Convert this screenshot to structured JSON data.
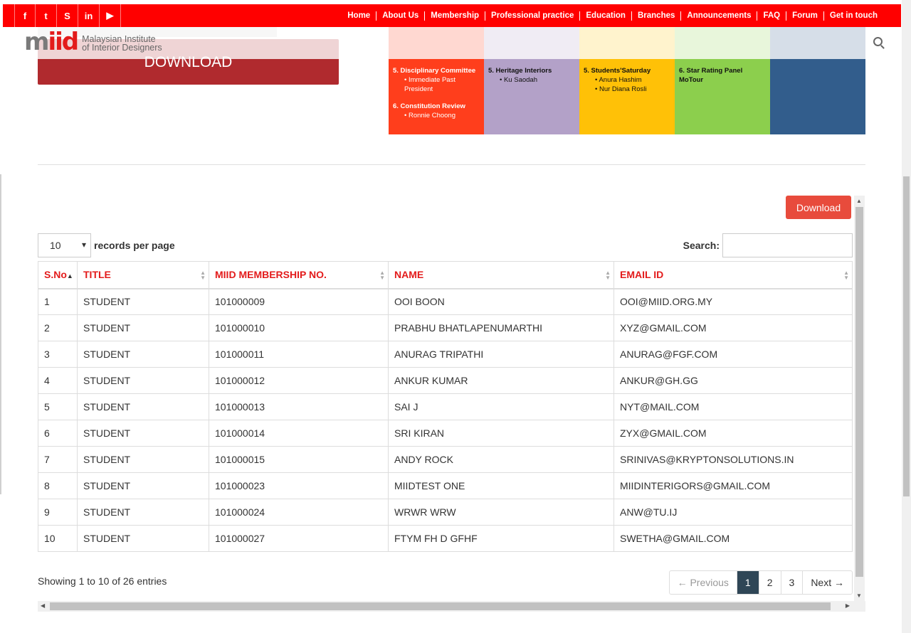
{
  "topbar": {
    "social": [
      {
        "icon": "facebook-icon",
        "glyph": "f"
      },
      {
        "icon": "twitter-icon",
        "glyph": "t"
      },
      {
        "icon": "skype-icon",
        "glyph": "S"
      },
      {
        "icon": "linkedin-icon",
        "glyph": "in"
      },
      {
        "icon": "youtube-icon",
        "glyph": "▶"
      }
    ],
    "nav": [
      "Home",
      "About Us",
      "Membership",
      "Professional practice",
      "Education",
      "Branches",
      "Announcements",
      "FAQ",
      "Forum",
      "Get in touch"
    ]
  },
  "header": {
    "logo_mark_gray": "m",
    "logo_mark_red": "iid",
    "logo_line1": "Malaysian Institute",
    "logo_line2": "of Interior Designers"
  },
  "banner": {
    "download_label": "DOWNLOAD"
  },
  "committees": {
    "col1": [
      {
        "head": "5.  Disciplinary Committee",
        "items": [
          "Immediate Past President"
        ]
      },
      {
        "head": "6.  Constitution Review",
        "items": [
          "Ronnie Choong"
        ]
      }
    ],
    "col2": [
      {
        "head": "5. Heritage Interiors",
        "items": [
          "Ku Saodah"
        ]
      }
    ],
    "col3": [
      {
        "head": "5.  Students'Saturday",
        "items": [
          "Anura Hashim",
          "Nur Diana Rosli"
        ]
      }
    ],
    "col4": [
      {
        "head": "6.  Star Rating Panel MoTour",
        "items": []
      }
    ]
  },
  "table_panel": {
    "download_button": "Download",
    "length_value": "10",
    "length_suffix": "records per page",
    "search_label": "Search:",
    "search_value": "",
    "columns": [
      "S.No",
      "TITLE",
      "MIID MEMBERSHIP NO.",
      "NAME",
      "EMAIL ID"
    ],
    "rows": [
      [
        "1",
        "STUDENT",
        "101000009",
        "OOI BOON",
        "OOI@MIID.ORG.MY"
      ],
      [
        "2",
        "STUDENT",
        "101000010",
        "PRABHU BHATLAPENUMARTHI",
        "XYZ@GMAIL.COM"
      ],
      [
        "3",
        "STUDENT",
        "101000011",
        "ANURAG TRIPATHI",
        "ANURAG@FGF.COM"
      ],
      [
        "4",
        "STUDENT",
        "101000012",
        "ANKUR KUMAR",
        "ANKUR@GH.GG"
      ],
      [
        "5",
        "STUDENT",
        "101000013",
        "SAI J",
        "NYT@MAIL.COM"
      ],
      [
        "6",
        "STUDENT",
        "101000014",
        "SRI KIRAN",
        "ZYX@GMAIL.COM"
      ],
      [
        "7",
        "STUDENT",
        "101000015",
        "ANDY ROCK",
        "SRINIVAS@KRYPTONSOLUTIONS.IN"
      ],
      [
        "8",
        "STUDENT",
        "101000023",
        "MIIDTEST ONE",
        "MIIDINTERIGORS@GMAIL.COM"
      ],
      [
        "9",
        "STUDENT",
        "101000024",
        "WRWR WRW",
        "ANW@TU.IJ"
      ],
      [
        "10",
        "STUDENT",
        "101000027",
        "FTYM FH D GFHF",
        "SWETHA@GMAIL.COM"
      ]
    ],
    "info": "Showing 1 to 10 of 26 entries",
    "pager": {
      "previous": "← Previous",
      "pages": [
        "1",
        "2",
        "3"
      ],
      "active": "1",
      "next": "Next →"
    }
  },
  "colors": {
    "brand_red": "#ff0000",
    "header_text_red": "#e31b1b",
    "download_button": "#e84b3c",
    "pager_active": "#2f4656"
  }
}
